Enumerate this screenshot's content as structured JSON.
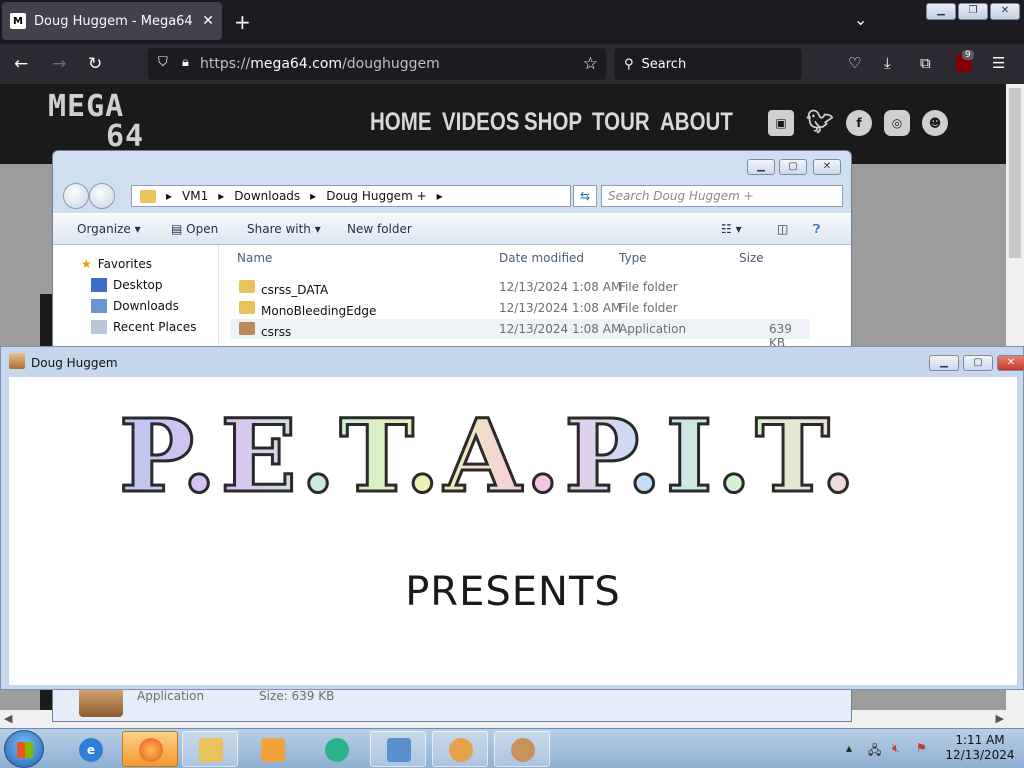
{
  "browser": {
    "tab_title": "Doug Huggem - Mega64",
    "url_scheme": "https://",
    "url_host": "mega64.com",
    "url_path": "/doughuggem",
    "search_placeholder": "Search",
    "extension_badge": "9",
    "new_tab": "+",
    "tab_close": "✕"
  },
  "site": {
    "logo_line1": "MEGA",
    "logo_line2": "64",
    "nav": [
      "HOME",
      "VIDEOS",
      "SHOP",
      "TOUR",
      "ABOUT"
    ]
  },
  "explorer": {
    "breadcrumb": [
      "VM1",
      "Downloads",
      "Doug Huggem +"
    ],
    "search_placeholder": "Search Doug Huggem +",
    "commands": {
      "organize": "Organize",
      "open": "Open",
      "share_with": "Share with",
      "new_folder": "New folder"
    },
    "nav_pane": [
      "Favorites",
      "Desktop",
      "Downloads",
      "Recent Places"
    ],
    "columns": [
      "Name",
      "Date modified",
      "Type",
      "Size"
    ],
    "files": [
      {
        "name": "csrss_DATA",
        "date": "12/13/2024 1:08 AM",
        "type": "File folder",
        "size": ""
      },
      {
        "name": "MonoBleedingEdge",
        "date": "12/13/2024 1:08 AM",
        "type": "File folder",
        "size": ""
      },
      {
        "name": "csrss",
        "date": "12/13/2024 1:08 AM",
        "type": "Application",
        "size": "639 KB"
      }
    ],
    "status_type": "Application",
    "status_size": "Size: 639 KB"
  },
  "app_window": {
    "title": "Doug Huggem",
    "headline": "P.E.T.A.P.I.T.",
    "subtitle": "PRESENTS"
  },
  "taskbar": {
    "time": "1:11 AM",
    "date": "12/13/2024"
  }
}
